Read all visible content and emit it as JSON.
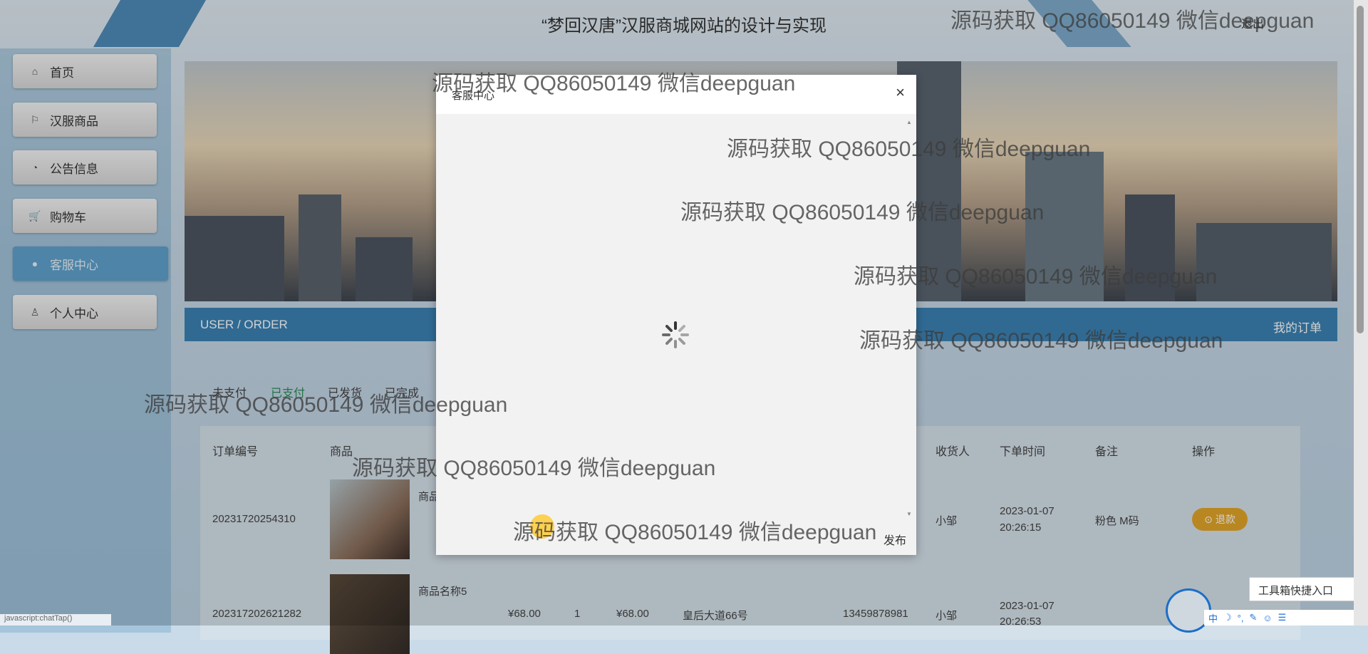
{
  "header": {
    "title": "“梦回汉唐”汉服商城网站的设计与实现",
    "logout_label": "退出"
  },
  "sidebar": {
    "items": [
      {
        "label": "首页",
        "icon": "home-icon"
      },
      {
        "label": "汉服商品",
        "icon": "flag-icon"
      },
      {
        "label": "公告信息",
        "icon": "gauge-icon"
      },
      {
        "label": "购物车",
        "icon": "cart-icon"
      },
      {
        "label": "客服中心",
        "icon": "chat-icon"
      },
      {
        "label": "个人中心",
        "icon": "user-icon"
      }
    ]
  },
  "userbar": {
    "left": "USER / ORDER",
    "right": "我的订单"
  },
  "tabs": [
    "未支付",
    "已支付",
    "已发货",
    "已完成"
  ],
  "table": {
    "headers": [
      "订单编号",
      "商品",
      "收货人",
      "下单时间",
      "备注",
      "操作"
    ],
    "rows": [
      {
        "order_no": "20231720254310",
        "product": "商品",
        "receiver": "小邹",
        "time_date": "2023-01-07",
        "time_clock": "20:26:15",
        "note": "粉色 M码",
        "action": "退款"
      },
      {
        "order_no": "202317202621282",
        "product": "商品名称5",
        "price": "¥68.00",
        "qty": "1",
        "total": "¥68.00",
        "address": "皇后大道66号",
        "phone": "13459878981",
        "receiver": "小邹",
        "time_date": "2023-01-07",
        "time_clock": "20:26:53"
      }
    ]
  },
  "modal": {
    "title": "客服中心",
    "close": "×",
    "publish": "发布"
  },
  "watermark": "源码获取 QQ86050149 微信deepguan",
  "statusbar": "javascript:chatTap()",
  "toolbox": {
    "label": "工具箱快捷入口",
    "close": "×"
  },
  "ime": [
    "中",
    "☽",
    "°,",
    "✎",
    "☺",
    "☰"
  ],
  "colors": {
    "accent": "#3b82b4",
    "refund": "#e2a529",
    "active_tab": "#2e8b57"
  }
}
